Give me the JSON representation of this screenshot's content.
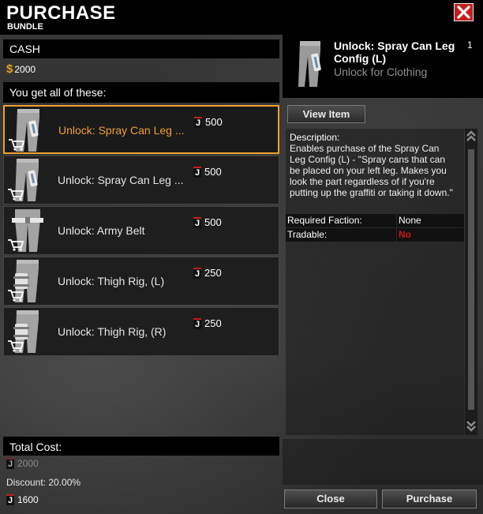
{
  "header": {
    "title": "PURCHASE",
    "subtitle": "BUNDLE"
  },
  "cash": {
    "label": "CASH",
    "amount": "2000"
  },
  "list_header": "You get all of these:",
  "items": [
    {
      "name": "Unlock: Spray Can Leg ...",
      "price": "500",
      "selected": true,
      "icon": "leg-spray-can-thumbnail"
    },
    {
      "name": "Unlock: Spray Can Leg ...",
      "price": "500",
      "selected": false,
      "icon": "leg-spray-can-thumbnail"
    },
    {
      "name": "Unlock: Army Belt",
      "price": "500",
      "selected": false,
      "icon": "army-belt-thumbnail"
    },
    {
      "name": "Unlock: Thigh Rig, (L)",
      "price": "250",
      "selected": false,
      "icon": "thigh-rig-thumbnail"
    },
    {
      "name": "Unlock: Thigh Rig, (R)",
      "price": "250",
      "selected": false,
      "icon": "thigh-rig-thumbnail"
    }
  ],
  "currency_glyph": "J",
  "total": {
    "label": "Total Cost:",
    "original": "2000",
    "discount": "Discount: 20.00%",
    "final": "1600"
  },
  "detail": {
    "name": "Unlock: Spray Can Leg Config (L)",
    "type": "Unlock for Clothing",
    "quantity": "1",
    "view_button": "View Item",
    "description_label": "Description:",
    "description": "Enables purchase of the Spray Can Leg Config (L) - \"Spray cans that can be placed on your left leg. Makes you look the part regardless of if you're putting up the graffiti or taking it down.\"",
    "properties": [
      {
        "key": "Required Faction:",
        "value": "None"
      },
      {
        "key": "Tradable:",
        "value": "No"
      }
    ]
  },
  "buttons": {
    "close": "Close",
    "purchase": "Purchase"
  },
  "colors": {
    "accent": "#f0a030",
    "close_red": "#c41e1e",
    "no_red": "#d0141a"
  }
}
